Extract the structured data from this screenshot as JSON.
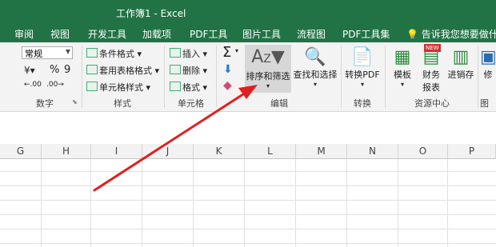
{
  "app": {
    "title": "工作簿1 - Excel",
    "accent": "#217346",
    "tabs": [
      "审阅",
      "视图",
      "开发工具",
      "加载项",
      "PDF工具",
      "图片工具",
      "流程图",
      "PDF工具集"
    ],
    "tellme": "告诉我您想要做什么..."
  },
  "ribbon": {
    "number": {
      "format_value": "常规",
      "percent": "%",
      "comma": "9",
      "label": "数字"
    },
    "styles": {
      "items": [
        "条件格式",
        "套用表格格式",
        "单元格样式"
      ],
      "label": "样式"
    },
    "cells": {
      "items": [
        "插入",
        "删除",
        "格式"
      ],
      "label": "单元格"
    },
    "editing": {
      "sort_filter": "排序和筛选",
      "find_select": "查找和选择",
      "label": "编辑"
    },
    "convert": {
      "to_pdf": "转换PDF",
      "label": "转换"
    },
    "resource": {
      "template": "模板",
      "finance_line1": "财务",
      "finance_line2": "报表",
      "invoicing": "进销存",
      "new_badge": "NEW",
      "label": "资源中心"
    },
    "image_group": {
      "label": "图片"
    },
    "partial_button": "修"
  },
  "sheet": {
    "columns": [
      "G",
      "H",
      "I",
      "J",
      "K",
      "L",
      "M",
      "N",
      "O",
      "P"
    ]
  },
  "annotation": {
    "arrow_color": "#e02020"
  }
}
